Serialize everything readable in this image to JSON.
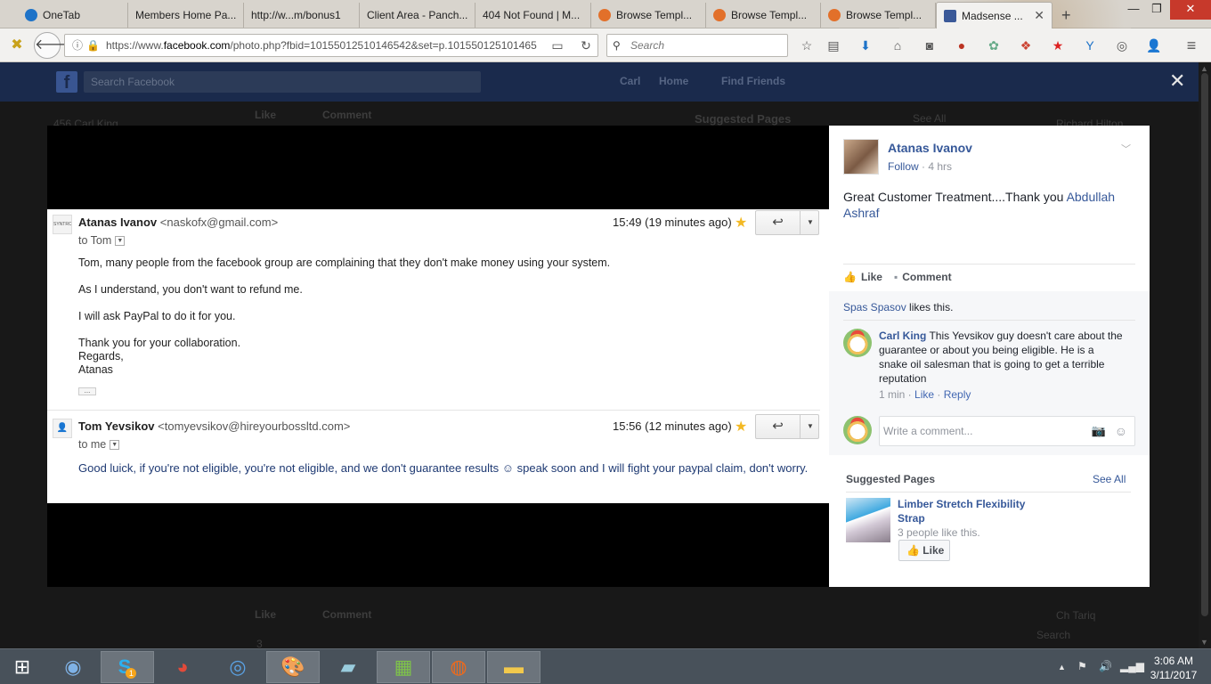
{
  "browser": {
    "tabs": [
      {
        "label": "OneTab",
        "color": "#1e73c8"
      },
      {
        "label": "Members Home Pa...",
        "color": ""
      },
      {
        "label": "http://w...m/bonus1",
        "color": ""
      },
      {
        "label": "Client Area - Panch...",
        "color": ""
      },
      {
        "label": "404 Not Found | M...",
        "color": ""
      },
      {
        "label": "Browse Templ...",
        "color": "#e2702a"
      },
      {
        "label": "Browse Templ...",
        "color": "#e2702a"
      },
      {
        "label": "Browse Templ...",
        "color": "#e2702a"
      },
      {
        "label": "Madsense ...",
        "color": "#3b5998"
      }
    ],
    "new_tab": "+",
    "url_prefix": "https://www.",
    "url_domain": "facebook.com",
    "url_rest": "/photo.php?fbid=10155012510146542&set=p.101550125101465",
    "search_placeholder": "Search"
  },
  "facebook": {
    "search_placeholder": "Search Facebook",
    "nav": [
      "Carl",
      "Home",
      "Find Friends"
    ],
    "bg_labels": [
      "Like",
      "Comment",
      "Suggested Pages",
      "See All",
      "Richard Hilton",
      "Like",
      "Comment",
      "Ch Tariq",
      "Search",
      "456 Carl King",
      "3"
    ]
  },
  "email": {
    "msg1": {
      "sender": "Atanas Ivanov",
      "email": "<naskofx@gmail.com>",
      "to": "to Tom",
      "time": "15:49 (19 minutes ago)",
      "avatar_text": "SYNTRONE",
      "lines": [
        "Tom, many people from the facebook group are complaining that they don't make money using your system.",
        "As I understand, you don't want to refund me.",
        "I will ask PayPal to do it for you.",
        "Thank you for your collaboration.",
        "Regards,",
        "Atanas"
      ],
      "dots": "..."
    },
    "msg2": {
      "sender": "Tom Yevsikov",
      "email": "<tomyevsikov@hireyourbossltd.com>",
      "to": "to me",
      "time": "15:56 (12 minutes ago)",
      "body": "Good luick, if you're not eligible, you're not eligible, and we don't guarantee results ☺ speak soon and I will fight your paypal claim, don't worry."
    }
  },
  "post": {
    "author": "Atanas Ivanov",
    "follow": "Follow",
    "time": "· 4 hrs",
    "text": "Great Customer Treatment....Thank you ",
    "mention": "Abdullah Ashraf",
    "like": "Like",
    "comment": "Comment",
    "liker": "Spas Spasov",
    "likes_suffix": " likes this.",
    "comment_author": "Carl King",
    "comment_text": " This Yevsikov guy doesn't care about the guarantee or about you being eligible. He is a snake oil salesman that is going to get a terrible reputation",
    "comment_time": "1 min",
    "comment_like": "Like",
    "comment_reply": "Reply",
    "write_placeholder": "Write a comment...",
    "suggested_title": "Suggested Pages",
    "see_all": "See All",
    "page_name": "Limber Stretch Flexibility Strap",
    "page_likes": "3 people like this.",
    "page_like_btn": "Like"
  },
  "taskbar": {
    "time": "3:06 AM",
    "date": "3/11/2017",
    "skype_badge": "1"
  },
  "colors": {
    "fb_blue": "#365899",
    "fb_dark": "#1a2b4f",
    "star": "#f3b924",
    "taskbar": "#48515a"
  }
}
